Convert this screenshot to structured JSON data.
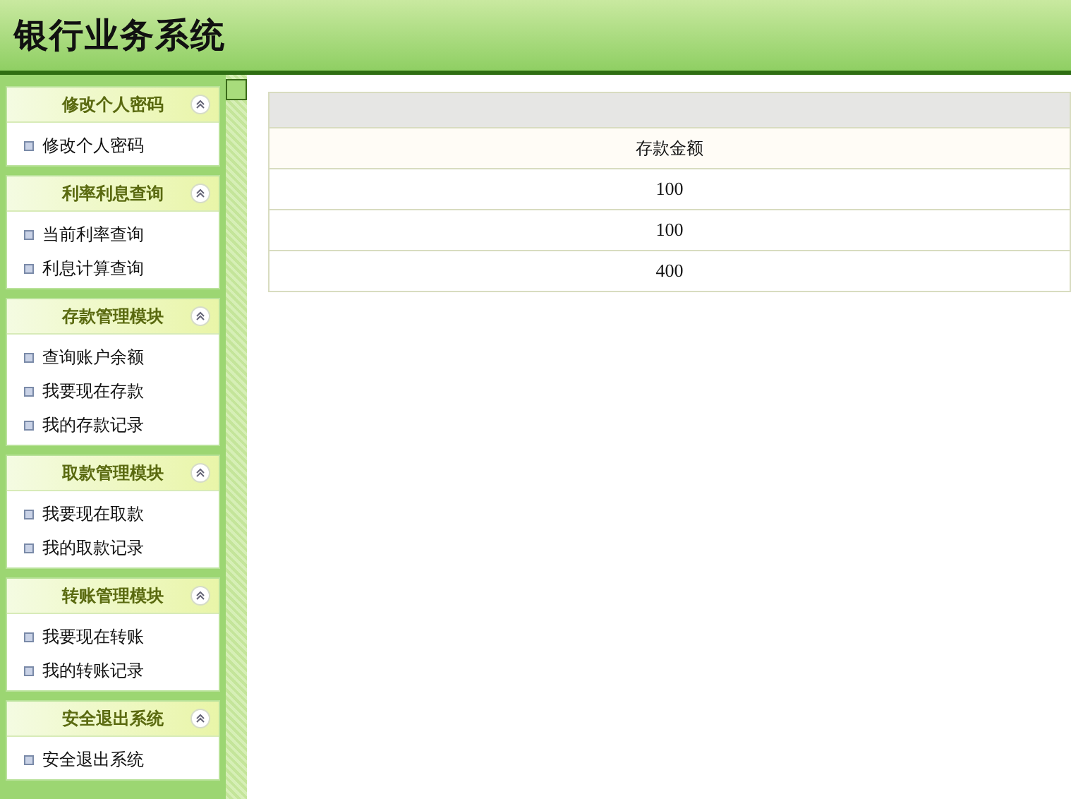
{
  "header": {
    "title": "银行业务系统"
  },
  "sidebar": {
    "panels": [
      {
        "title": "修改个人密码",
        "expanded": true,
        "items": [
          "修改个人密码"
        ]
      },
      {
        "title": "利率利息查询",
        "expanded": true,
        "items": [
          "当前利率查询",
          "利息计算查询"
        ]
      },
      {
        "title": "存款管理模块",
        "expanded": true,
        "items": [
          "查询账户余额",
          "我要现在存款",
          "我的存款记录"
        ]
      },
      {
        "title": "取款管理模块",
        "expanded": true,
        "items": [
          "我要现在取款",
          "我的取款记录"
        ]
      },
      {
        "title": "转账管理模块",
        "expanded": true,
        "items": [
          "我要现在转账",
          "我的转账记录"
        ]
      },
      {
        "title": "安全退出系统",
        "expanded": true,
        "items": [
          "安全退出系统"
        ]
      }
    ]
  },
  "table": {
    "columns": [
      "存款金额"
    ],
    "rows": [
      [
        "100"
      ],
      [
        "100"
      ],
      [
        "400"
      ]
    ]
  }
}
